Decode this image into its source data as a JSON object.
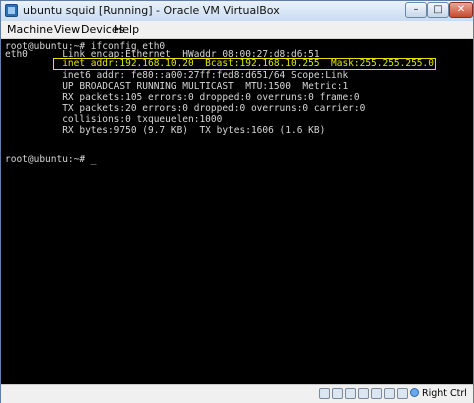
{
  "window": {
    "title": "ubuntu squid [Running] - Oracle VM VirtualBox",
    "controls": {
      "minimize": "–",
      "maximize": "□",
      "close": "✕"
    }
  },
  "menu": [
    "Machine",
    "View",
    "Devices",
    "Help"
  ],
  "terminal": {
    "lines": [
      "root@ubuntu:~# ifconfig eth0",
      "eth0      Link encap:Ethernet  HWaddr 08:00:27:d8:d6:51",
      "          inet addr:192.168.10.20  Bcast:192.168.10.255  Mask:255.255.255.0",
      "          inet6 addr: fe80::a00:27ff:fed8:d651/64 Scope:Link",
      "          UP BROADCAST RUNNING MULTICAST  MTU:1500  Metric:1",
      "          RX packets:105 errors:0 dropped:0 overruns:0 frame:0",
      "          TX packets:20 errors:0 dropped:0 overruns:0 carrier:0",
      "          collisions:0 txqueuelen:1000",
      "          RX bytes:9750 (9.7 KB)  TX bytes:1606 (1.6 KB)",
      "",
      "root@ubuntu:~# _"
    ],
    "highlighted_line_index": 2,
    "text_color": "#d6d6d6",
    "highlight_color": "#e4e400",
    "background": "#000000"
  },
  "statusbar": {
    "icons": [
      "hard-disk-icon",
      "optical-drive-icon",
      "usb-icon",
      "shared-folder-icon",
      "network-icon",
      "display-icon",
      "mouse-integration-icon"
    ],
    "host_key_label": "Right Ctrl"
  }
}
